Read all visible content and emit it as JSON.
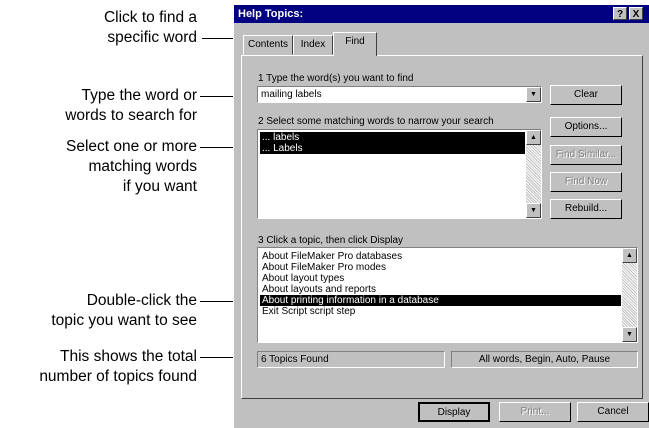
{
  "callouts": {
    "find_tab": [
      "Click to find a",
      "specific word"
    ],
    "type_word": [
      "Type the word or",
      "words to search for"
    ],
    "select_words": [
      "Select one or more",
      "matching words",
      "if you want"
    ],
    "double_click": [
      "Double-click the",
      "topic you want to see"
    ],
    "total_topics": [
      "This shows the total",
      "number of topics found"
    ]
  },
  "dialog": {
    "title": "Help Topics:",
    "help_btn": "?",
    "close_btn": "X",
    "tabs": [
      "Contents",
      "Index",
      "Find"
    ],
    "active_tab": "Find",
    "step1_label": "1 Type the word(s) you want to find",
    "search_value": "mailing labels",
    "step2_label": "2 Select some matching words to narrow your search",
    "matching_words": [
      "... labels",
      "... Labels"
    ],
    "step3_label": "3 Click a topic, then click Display",
    "topics": [
      "About FileMaker Pro databases",
      "About FileMaker Pro modes",
      "About layout types",
      "About layouts and reports",
      "About printing information in a database",
      "Exit Script script step"
    ],
    "selected_topic": "About printing information in a database",
    "status_count": "6 Topics Found",
    "status_options": "All words, Begin, Auto, Pause",
    "buttons": {
      "clear": "Clear",
      "options": "Options...",
      "find_similar": "Find Similar...",
      "find_now": "Find Now",
      "rebuild": "Rebuild...",
      "display": "Display",
      "print": "Print...",
      "cancel": "Cancel"
    }
  }
}
